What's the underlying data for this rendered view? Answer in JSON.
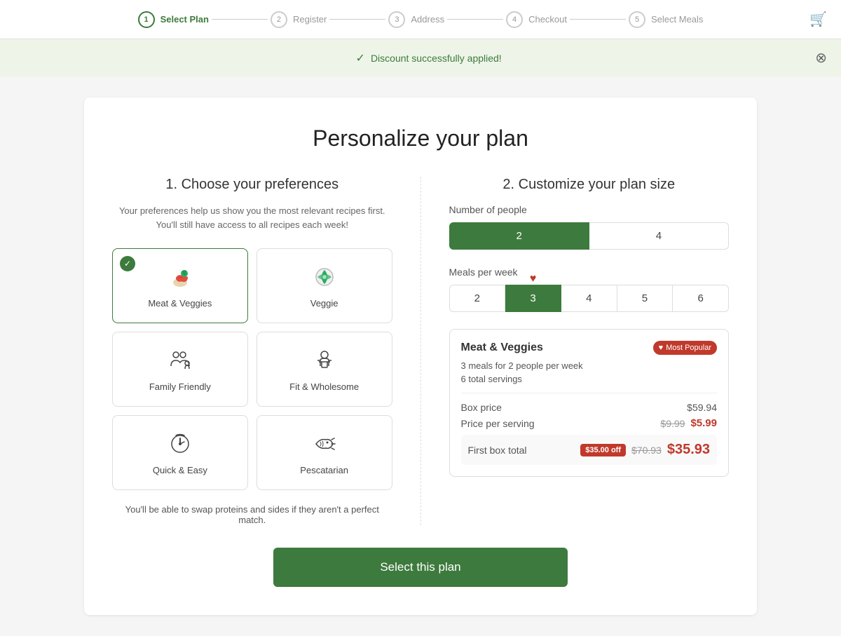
{
  "header": {
    "steps": [
      {
        "num": "1",
        "label": "Select Plan",
        "active": true
      },
      {
        "num": "2",
        "label": "Register",
        "active": false
      },
      {
        "num": "3",
        "label": "Address",
        "active": false
      },
      {
        "num": "4",
        "label": "Checkout",
        "active": false
      },
      {
        "num": "5",
        "label": "Select Meals",
        "active": false
      }
    ],
    "cart_icon": "🛒"
  },
  "discount_banner": {
    "message": "Discount successfully applied!",
    "close_icon": "⊗"
  },
  "page": {
    "title": "Personalize your plan",
    "section1_title": "1. Choose your preferences",
    "section1_subtitle": "Your preferences help us show you the most relevant recipes first. You'll still have access to all recipes each week!",
    "preferences": [
      {
        "id": "meat-veggies",
        "label": "Meat & Veggies",
        "selected": true
      },
      {
        "id": "veggie",
        "label": "Veggie",
        "selected": false
      },
      {
        "id": "family-friendly",
        "label": "Family Friendly",
        "selected": false
      },
      {
        "id": "fit-wholesome",
        "label": "Fit & Wholesome",
        "selected": false
      },
      {
        "id": "quick-easy",
        "label": "Quick & Easy",
        "selected": false
      },
      {
        "id": "pescatarian",
        "label": "Pescatarian",
        "selected": false
      }
    ],
    "swap_note": "You'll be able to swap proteins and sides if they aren't a perfect match.",
    "section2_title": "2. Customize your plan size",
    "number_of_people_label": "Number of people",
    "people_options": [
      "2",
      "4"
    ],
    "people_selected": "2",
    "meals_per_week_label": "Meals per week",
    "meals_options": [
      "2",
      "3",
      "4",
      "5",
      "6"
    ],
    "meals_selected": "3",
    "plan_summary": {
      "title": "Meat & Veggies",
      "badge": "Most Popular",
      "detail1": "3 meals for 2 people per week",
      "detail2": "6 total servings",
      "box_price_label": "Box price",
      "box_price": "$59.94",
      "per_serving_label": "Price per serving",
      "per_serving_original": "$9.99",
      "per_serving_discounted": "$5.99",
      "first_box_label": "First box total",
      "discount_tag": "$35.00 off",
      "total_original": "$70.93",
      "total_final": "$35.93"
    },
    "cta_label": "Select this plan"
  },
  "colors": {
    "green": "#3d7a3d",
    "red": "#c0392b",
    "light_green_bg": "#eef5e8"
  }
}
